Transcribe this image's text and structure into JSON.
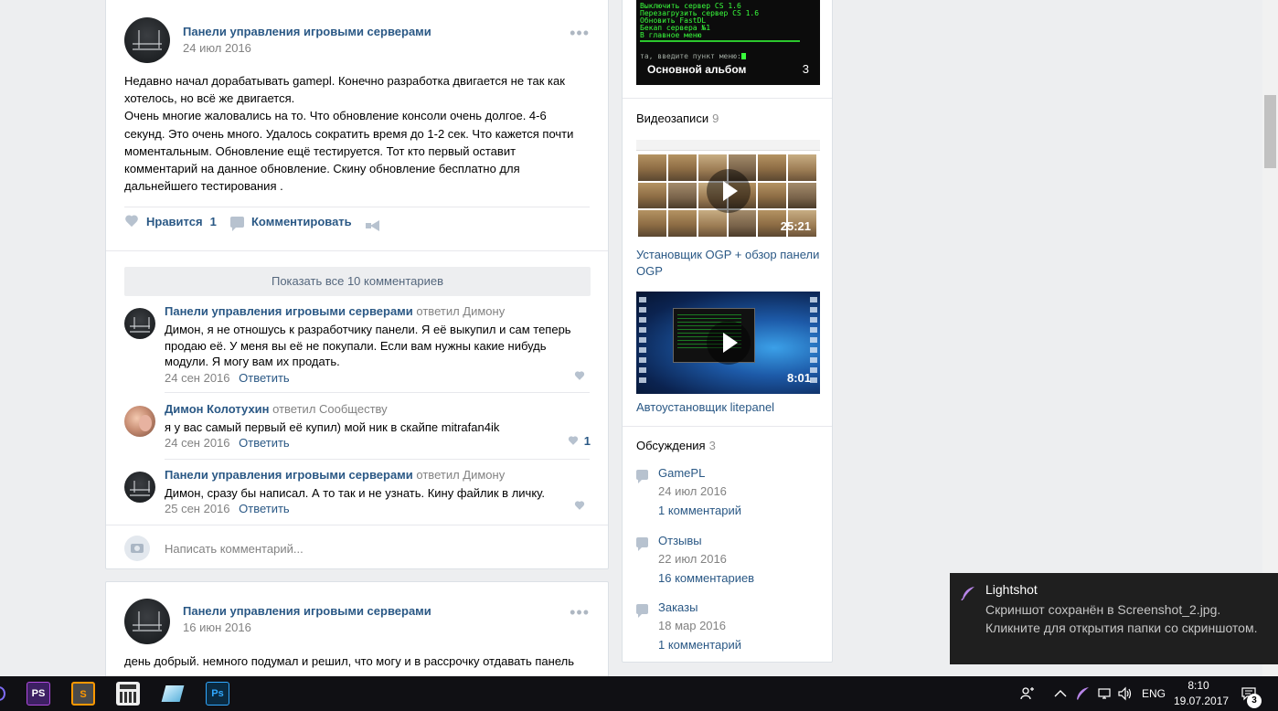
{
  "post1": {
    "author": "Панели управления игровыми серверами",
    "date": "24 июл 2016",
    "menu": "•••",
    "text_lines": [
      "Недавно начал дорабатывать gamepl. Конечно разработка двигается не так как",
      "хотелось, но всё же двигается.",
      "Очень многие жаловались на то. Что обновление консоли очень долгое. 4-6",
      "секунд. Это очень много. Удалось сократить время до 1-2 сек. Что кажется почти",
      "моментальным. Обновление ещё тестируется. Тот кто первый оставит",
      "комментарий на данное обновление. Скину обновление бесплатно для",
      "дальнейшего тестирования ."
    ],
    "like_label": "Нравится",
    "like_count": "1",
    "comment_label": "Комментировать",
    "show_all": "Показать все 10 комментариев",
    "replies": [
      {
        "author": "Панели управления игровыми серверами",
        "action": "ответил Димону",
        "lines": [
          "Димон, я не отношусь к разработчику панели. Я её выкупил и сам теперь",
          "продаю её. У меня вы её не покупали. Если вам нужны какие нибудь",
          "модули. Я могу вам их продать."
        ],
        "date": "24 сен 2016",
        "reply": "Ответить",
        "likes": ""
      },
      {
        "author": "Димон Колотухин",
        "action": "ответил Сообществу",
        "lines": [
          "я у вас самый первый её купил) мой ник в скайпе mitrafan4ik"
        ],
        "date": "24 сен 2016",
        "reply": "Ответить",
        "likes": "1"
      },
      {
        "author": "Панели управления игровыми серверами",
        "action": "ответил Димону",
        "lines": [
          "Димон, сразу бы написал. А то так и не узнать. Кину файлик в личку."
        ],
        "date": "25 сен 2016",
        "reply": "Ответить",
        "likes": ""
      }
    ],
    "comment_placeholder": "Написать комментарий..."
  },
  "post2": {
    "author": "Панели управления игровыми серверами",
    "date": "16 июн 2016",
    "menu": "•••",
    "text": "день добрый. немного подумал и решил, что могу и в рассрочку отдавать панель"
  },
  "sidebar": {
    "album": {
      "terminal_lines": [
        "Выключить сервер CS 1.6",
        "Перезагрузить сервер CS 1.6",
        "Обновить FastDL",
        "Бекап сервера №1",
        "В главное меню"
      ],
      "terminal_prompt": "та, введите пункт меню:",
      "label": "Основной альбом",
      "count": "3"
    },
    "videos_title": "Видеозаписи",
    "videos_count": "9",
    "videos": [
      {
        "title": "Установщик OGP + обзор панели OGP",
        "duration": "25:21"
      },
      {
        "title": "Автоустановщик litepanel",
        "duration": "8:01"
      }
    ],
    "discussions_title": "Обсуждения",
    "discussions_count": "3",
    "discussions": [
      {
        "title": "GamePL",
        "date": "24 июл 2016",
        "comments": "1 комментарий"
      },
      {
        "title": "Отзывы",
        "date": "22 июл 2016",
        "comments": "16 комментариев"
      },
      {
        "title": "Заказы",
        "date": "18 мар 2016",
        "comments": "1 комментарий"
      }
    ]
  },
  "toast": {
    "title": "Lightshot",
    "body": "Скриншот сохранён в Screenshot_2.jpg. Кликните для открытия папки со скриншотом."
  },
  "taskbar": {
    "apps": [
      "PS",
      "S",
      "calc",
      "glass",
      "Ps"
    ],
    "lang": "ENG",
    "time": "8:10",
    "date": "19.07.2017",
    "notifications": "3"
  },
  "colors": {
    "link": "#2a5885",
    "bg": "#edeef0",
    "terminal": "#39ff3c",
    "taskbar": "#101014"
  }
}
